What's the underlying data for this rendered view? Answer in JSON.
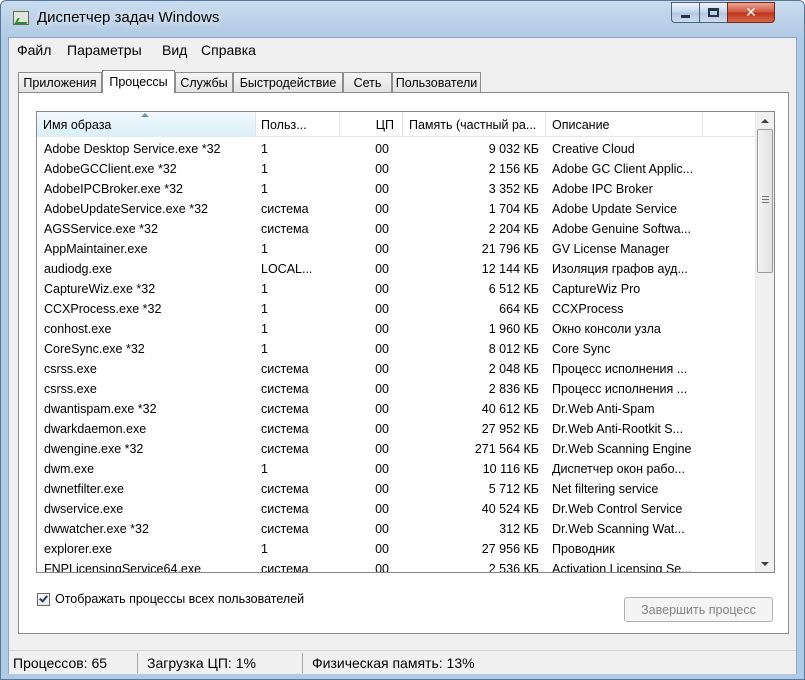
{
  "window": {
    "title": "Диспетчер задач Windows"
  },
  "menu": [
    "Файл",
    "Параметры",
    "Вид",
    "Справка"
  ],
  "tabs": [
    "Приложения",
    "Процессы",
    "Службы",
    "Быстродействие",
    "Сеть",
    "Пользователи"
  ],
  "active_tab": "Процессы",
  "columns": {
    "name": "Имя образа",
    "user": "Польз...",
    "cpu": "ЦП",
    "memory": "Память (частный ра...",
    "description": "Описание"
  },
  "sort_column": "Имя образа",
  "processes": [
    {
      "name": "Adobe Desktop Service.exe *32",
      "user": "1",
      "cpu": "00",
      "mem": "9 032 КБ",
      "desc": "Creative Cloud"
    },
    {
      "name": "AdobeGCClient.exe *32",
      "user": "1",
      "cpu": "00",
      "mem": "2 156 КБ",
      "desc": "Adobe GC Client Applic..."
    },
    {
      "name": "AdobeIPCBroker.exe *32",
      "user": "1",
      "cpu": "00",
      "mem": "3 352 КБ",
      "desc": "Adobe IPC Broker"
    },
    {
      "name": "AdobeUpdateService.exe *32",
      "user": "система",
      "cpu": "00",
      "mem": "1 704 КБ",
      "desc": "Adobe Update Service"
    },
    {
      "name": "AGSService.exe *32",
      "user": "система",
      "cpu": "00",
      "mem": "2 204 КБ",
      "desc": "Adobe Genuine Softwa..."
    },
    {
      "name": "AppMaintainer.exe",
      "user": "1",
      "cpu": "00",
      "mem": "21 796 КБ",
      "desc": "GV License Manager"
    },
    {
      "name": "audiodg.exe",
      "user": "LOCAL...",
      "cpu": "00",
      "mem": "12 144 КБ",
      "desc": "Изоляция графов ауд..."
    },
    {
      "name": "CaptureWiz.exe *32",
      "user": "1",
      "cpu": "00",
      "mem": "6 512 КБ",
      "desc": "CaptureWiz Pro"
    },
    {
      "name": "CCXProcess.exe *32",
      "user": "1",
      "cpu": "00",
      "mem": "664 КБ",
      "desc": "CCXProcess"
    },
    {
      "name": "conhost.exe",
      "user": "1",
      "cpu": "00",
      "mem": "1 960 КБ",
      "desc": "Окно консоли узла"
    },
    {
      "name": "CoreSync.exe *32",
      "user": "1",
      "cpu": "00",
      "mem": "8 012 КБ",
      "desc": "Core Sync"
    },
    {
      "name": "csrss.exe",
      "user": "система",
      "cpu": "00",
      "mem": "2 048 КБ",
      "desc": "Процесс исполнения ..."
    },
    {
      "name": "csrss.exe",
      "user": "система",
      "cpu": "00",
      "mem": "2 836 КБ",
      "desc": "Процесс исполнения ..."
    },
    {
      "name": "dwantispam.exe *32",
      "user": "система",
      "cpu": "00",
      "mem": "40 612 КБ",
      "desc": "Dr.Web Anti-Spam"
    },
    {
      "name": "dwarkdaemon.exe",
      "user": "система",
      "cpu": "00",
      "mem": "27 952 КБ",
      "desc": "Dr.Web Anti-Rootkit S..."
    },
    {
      "name": "dwengine.exe *32",
      "user": "система",
      "cpu": "00",
      "mem": "271 564 КБ",
      "desc": "Dr.Web Scanning Engine"
    },
    {
      "name": "dwm.exe",
      "user": "1",
      "cpu": "00",
      "mem": "10 116 КБ",
      "desc": "Диспетчер окон рабо..."
    },
    {
      "name": "dwnetfilter.exe",
      "user": "система",
      "cpu": "00",
      "mem": "5 712 КБ",
      "desc": "Net filtering service"
    },
    {
      "name": "dwservice.exe",
      "user": "система",
      "cpu": "00",
      "mem": "40 524 КБ",
      "desc": "Dr.Web Control Service"
    },
    {
      "name": "dwwatcher.exe *32",
      "user": "система",
      "cpu": "00",
      "mem": "312 КБ",
      "desc": "Dr.Web Scanning Wat..."
    },
    {
      "name": "explorer.exe",
      "user": "1",
      "cpu": "00",
      "mem": "27 956 КБ",
      "desc": "Проводник"
    },
    {
      "name": "FNPLicensingService64.exe",
      "user": "система",
      "cpu": "00",
      "mem": "2 536 КБ",
      "desc": "Activation Licensing Se..."
    }
  ],
  "show_all_users": {
    "label": "Отображать процессы всех пользователей",
    "checked": true
  },
  "end_process_button": "Завершить процесс",
  "status": {
    "processes": "Процессов: 65",
    "cpu_load": "Загрузка ЦП: 1%",
    "physical_memory": "Физическая память: 13%"
  }
}
